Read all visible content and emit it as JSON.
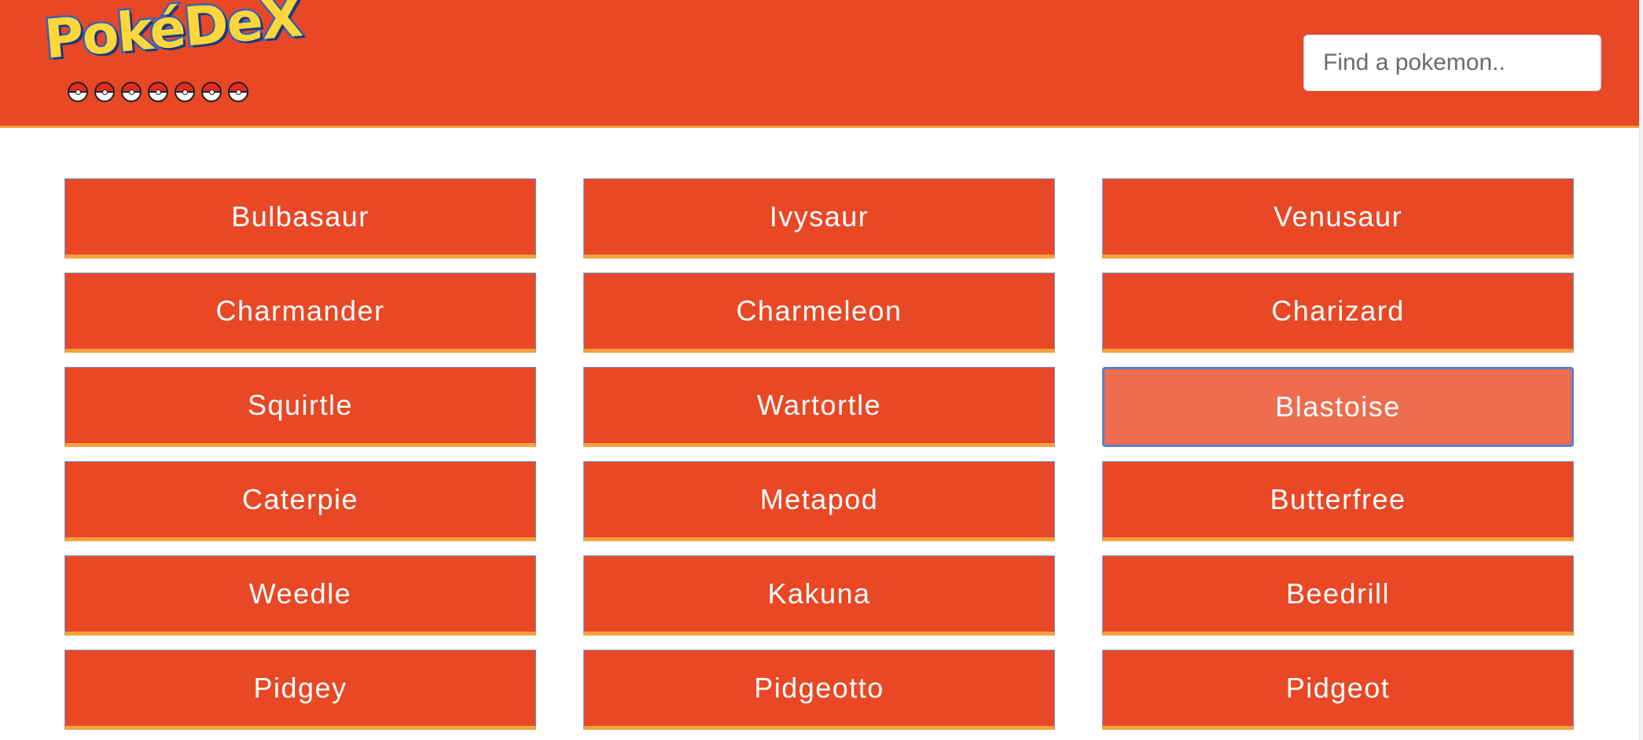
{
  "colors": {
    "brand": "#e84825",
    "hover": "#ee6d4f",
    "accent_bottom": "#f6a13a"
  },
  "header": {
    "logo_text": "PokéDeX",
    "search": {
      "placeholder": "Find a pokemon..",
      "value": ""
    }
  },
  "pokemon": [
    "Bulbasaur",
    "Ivysaur",
    "Venusaur",
    "Charmander",
    "Charmeleon",
    "Charizard",
    "Squirtle",
    "Wartortle",
    "Blastoise",
    "Caterpie",
    "Metapod",
    "Butterfree",
    "Weedle",
    "Kakuna",
    "Beedrill",
    "Pidgey",
    "Pidgeotto",
    "Pidgeot"
  ],
  "hovered": "Blastoise"
}
